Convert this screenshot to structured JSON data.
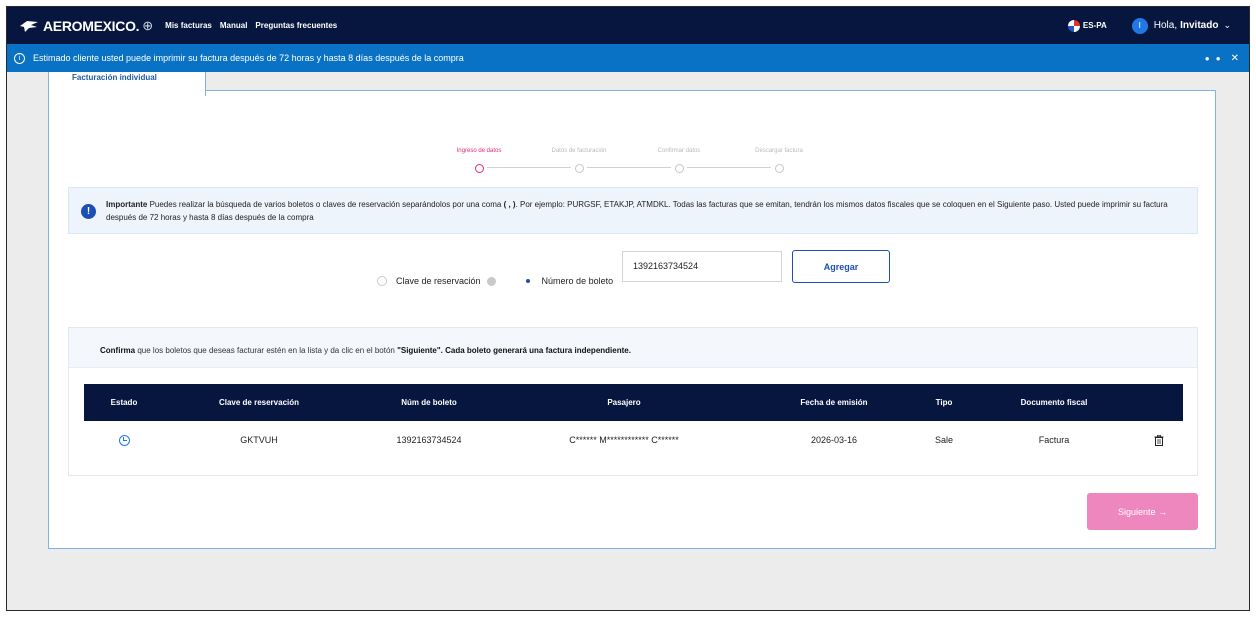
{
  "header": {
    "brand": "AEROMEXICO.",
    "nav": [
      "Mis facturas",
      "Manual",
      "Preguntas frecuentes"
    ],
    "lang": "ES-PA",
    "user_initial": "I",
    "greeting": "Hola,",
    "user_name": "Invitado"
  },
  "banner": {
    "text": "Estimado cliente usted puede imprimir su factura después de 72 horas y hasta 8 días después de la compra"
  },
  "tab": {
    "label": "Facturación individual"
  },
  "stepper": {
    "steps": [
      "Ingreso de datos",
      "Datos de facturación",
      "Confirmar datos",
      "Descargar factura"
    ],
    "active_index": 0
  },
  "info": {
    "bold": "Importante",
    "text_before": " Puedes realizar la búsqueda de varios boletos o claves de reservación separándolos por una coma ",
    "comma": "( , )",
    "text_after": ". Por ejemplo: PURGSF, ETAKJP, ATMDKL. Todas las facturas que se emitan, tendrán los mismos datos fiscales que se coloquen en el Siguiente paso. Usted puede imprimir su factura después de 72 horas y hasta 8 días después de la compra"
  },
  "form": {
    "radio_reservation": "Clave de reservación",
    "radio_ticket": "Número de boleto",
    "ticket_value": "1392163734524",
    "add_button": "Agregar"
  },
  "confirm": {
    "bold1": "Confirma",
    "text1": " que los boletos que deseas facturar estén en la lista y da clic en el botón ",
    "bold2": "\"Siguiente\". Cada boleto generará una factura independiente."
  },
  "table": {
    "headers": [
      "Estado",
      "Clave de reservación",
      "Núm de boleto",
      "Pasajero",
      "Fecha de emisión",
      "Tipo",
      "Documento fiscal"
    ],
    "rows": [
      {
        "status_icon": "clock-icon",
        "reservation": "GKTVUH",
        "ticket": "1392163734524",
        "passenger": "C****** M************ C******",
        "date": "2026-03-16",
        "type": "Sale",
        "document": "Factura",
        "action_icon": "trash-icon"
      }
    ]
  },
  "footer": {
    "next_button": "Siguiente →"
  },
  "colors": {
    "navy": "#06163f",
    "banner_blue": "#0a72c5",
    "accent_blue": "#1b4fb5",
    "step_pink": "#e0287a",
    "next_pink": "#ef87bf"
  }
}
